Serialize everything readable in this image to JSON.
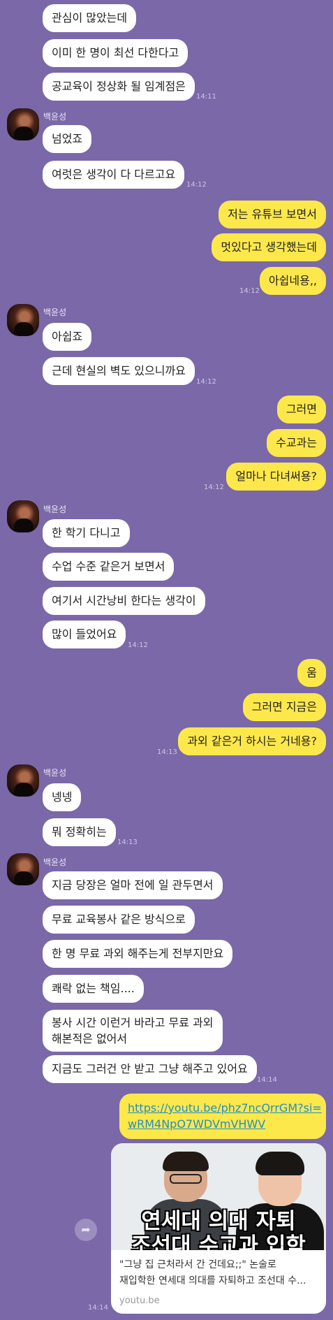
{
  "sender_name": "백윤성",
  "messages": [
    {
      "from": "them",
      "text": "관심이 많았는데"
    },
    {
      "from": "them",
      "text": "이미 한 명이 최선 다한다고"
    },
    {
      "from": "them",
      "text": "공교육이 정상화 될 임계점은",
      "time": "14:11"
    },
    {
      "from": "them",
      "text": "넘었죠"
    },
    {
      "from": "them",
      "text": "여럿은 생각이 다 다르고요",
      "time": "14:12"
    },
    {
      "from": "me",
      "text": "저는 유튜브 보면서"
    },
    {
      "from": "me",
      "text": "멋있다고 생각했는데"
    },
    {
      "from": "me",
      "text": "아쉽네용,,",
      "time": "14:12"
    },
    {
      "from": "them",
      "text": "아쉽죠"
    },
    {
      "from": "them",
      "text": "근데 현실의 벽도 있으니까요",
      "time": "14:12"
    },
    {
      "from": "me",
      "text": "그러면"
    },
    {
      "from": "me",
      "text": "수교과는"
    },
    {
      "from": "me",
      "text": "얼마나 다녀써용?",
      "time": "14:12"
    },
    {
      "from": "them",
      "text": "한 학기 다니고"
    },
    {
      "from": "them",
      "text": "수업 수준 같은거 보면서"
    },
    {
      "from": "them",
      "text": "여기서 시간낭비 한다는 생각이"
    },
    {
      "from": "them",
      "text": "많이 들었어요",
      "time": "14:12"
    },
    {
      "from": "me",
      "text": "움"
    },
    {
      "from": "me",
      "text": "그러면 지금은"
    },
    {
      "from": "me",
      "text": "과외 같은거 하시는 거네용?",
      "time": "14:13"
    },
    {
      "from": "them",
      "text": "넹넹"
    },
    {
      "from": "them",
      "text": "뭐 정확히는",
      "time": "14:13"
    },
    {
      "from": "them",
      "text": "지금 당장은 얼마 전에 일 관두면서"
    },
    {
      "from": "them",
      "text": "무료 교육봉사 같은 방식으로"
    },
    {
      "from": "them",
      "text": "한 명 무료 과외 해주는게 전부지만요"
    },
    {
      "from": "them",
      "text": "쾌락 없는 책임...."
    },
    {
      "from": "them",
      "text_line1": "봉사 시간 이런거 바라고 무료 과외",
      "text_line2": "해본적은 없어서"
    },
    {
      "from": "them",
      "text": "지금도 그러건 안 받고 그냥 해주고 있어요",
      "time": "14:14"
    }
  ],
  "link_message": {
    "url_line1": "https://youtu.be/phz7ncQrrGM?si=",
    "url_line2": "wRM4NpO7WDVmVHWV",
    "preview": {
      "thumbnail_caption_line1": "연세대 의대 자퇴",
      "thumbnail_caption_line2": "조선대 수교과 입학",
      "title_line1": "\"그냥 집 근처라서 간 건데요;;\" 논술로",
      "title_line2": "재입학한 연세대 의대를 자퇴하고 조선대 수...",
      "domain": "youtu.be"
    },
    "time": "14:14"
  },
  "icons": {
    "share": "share-icon",
    "avatar": "profile-avatar"
  },
  "colors": {
    "background": "#7a68a8",
    "my_bubble": "#fde84b",
    "their_bubble": "#ffffff",
    "link": "#1f8fc9"
  }
}
